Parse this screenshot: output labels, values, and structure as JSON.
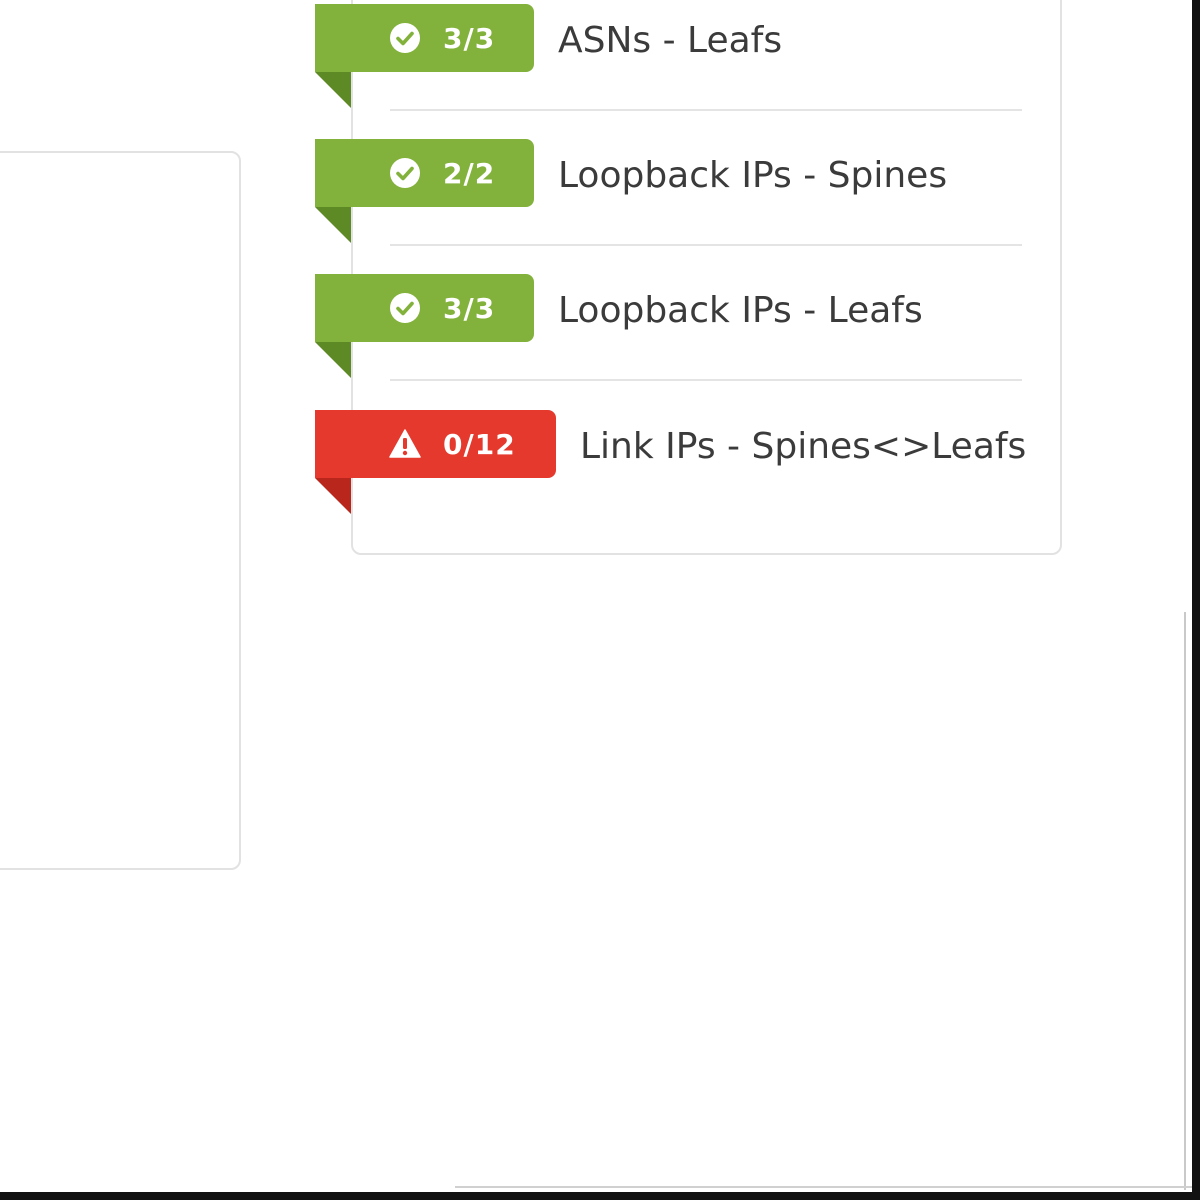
{
  "colors": {
    "success": "#83b23c",
    "success_fold": "#5e8a26",
    "error": "#e5392e",
    "error_fold": "#b8261c",
    "label": "#3b3b3b"
  },
  "resources": [
    {
      "status": "ok",
      "icon": "check-circle-icon",
      "count": "3/3",
      "label": "ASNs - Leafs"
    },
    {
      "status": "ok",
      "icon": "check-circle-icon",
      "count": "2/2",
      "label": "Loopback IPs - Spines"
    },
    {
      "status": "ok",
      "icon": "check-circle-icon",
      "count": "3/3",
      "label": "Loopback IPs - Leafs"
    },
    {
      "status": "error",
      "icon": "warning-triangle-icon",
      "count": "0/12",
      "label": "Link IPs - Spines<>Leafs"
    }
  ]
}
